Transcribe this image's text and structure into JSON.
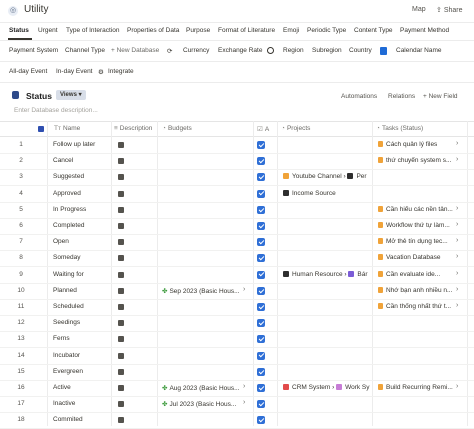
{
  "app": {
    "title": "Utility",
    "map": "Map",
    "share": "Share"
  },
  "tabs_row1": [
    "Status",
    "Urgent",
    "Type of Interaction",
    "Properties of Data",
    "Purpose",
    "Format of Literature",
    "Emoji",
    "Periodic Type",
    "Content Type",
    "Payment Method"
  ],
  "tabs_row2": [
    "Payment System",
    "Channel Type",
    "+ New Database",
    "Currency",
    "Exchange Rate",
    "Region",
    "Subregion",
    "Country",
    "Calendar Name"
  ],
  "tabs_row3": [
    "All-day Event",
    "In-day Event",
    "Integrate"
  ],
  "database": {
    "title": "Status",
    "views_label": "Views",
    "description_placeholder": "Enter Database description...",
    "automations": "Automations",
    "relations": "Relations",
    "new_field": "+ New Field"
  },
  "columns": {
    "name": "Name",
    "description": "Description",
    "budgets": "Budgets",
    "active": "A",
    "projects": "Projects",
    "tasks": "Tasks (Status)"
  },
  "rows": [
    {
      "n": "1",
      "name": "Follow up later",
      "budget": "",
      "projects": [],
      "task": "Cách quản lý files"
    },
    {
      "n": "2",
      "name": "Cancel",
      "budget": "",
      "projects": [],
      "task": "thứ chuyển system s..."
    },
    {
      "n": "3",
      "name": "Suggested",
      "budget": "",
      "projects": [
        "Youtube Channel",
        "Per"
      ],
      "task": ""
    },
    {
      "n": "4",
      "name": "Approved",
      "budget": "",
      "projects": [
        "Income Source"
      ],
      "task": ""
    },
    {
      "n": "5",
      "name": "In Progress",
      "budget": "",
      "projects": [],
      "task": "Cần hiểu các nền tản..."
    },
    {
      "n": "6",
      "name": "Completed",
      "budget": "",
      "projects": [],
      "task": "Workflow thứ tự làm..."
    },
    {
      "n": "7",
      "name": "Open",
      "budget": "",
      "projects": [],
      "task": "Mở thẻ tín dụng tec..."
    },
    {
      "n": "8",
      "name": "Someday",
      "budget": "",
      "projects": [],
      "task": "Vacation Database"
    },
    {
      "n": "9",
      "name": "Waiting for",
      "budget": "",
      "projects": [
        "Human Resource",
        "Bár"
      ],
      "task": "Cần evaluate ide..."
    },
    {
      "n": "10",
      "name": "Planned",
      "budget": "Sep 2023 (Basic Hous...",
      "projects": [],
      "task": "Nhớ bạn anh nhiều n..."
    },
    {
      "n": "11",
      "name": "Scheduled",
      "budget": "",
      "projects": [],
      "task": "Cần thống nhất thứ t..."
    },
    {
      "n": "12",
      "name": "Seedings",
      "budget": "",
      "projects": [],
      "task": ""
    },
    {
      "n": "13",
      "name": "Ferns",
      "budget": "",
      "projects": [],
      "task": ""
    },
    {
      "n": "14",
      "name": "Incubator",
      "budget": "",
      "projects": [],
      "task": ""
    },
    {
      "n": "15",
      "name": "Evergreen",
      "budget": "",
      "projects": [],
      "task": ""
    },
    {
      "n": "16",
      "name": "Active",
      "budget": "Aug 2023 (Basic Hous...",
      "projects": [
        "CRM System",
        "Work Sy"
      ],
      "task": "Build Recurring Remi..."
    },
    {
      "n": "17",
      "name": "Inactive",
      "budget": "Jul 2023 (Basic Hous...",
      "projects": [],
      "task": ""
    },
    {
      "n": "18",
      "name": "Commited",
      "budget": "",
      "projects": [],
      "task": ""
    }
  ]
}
